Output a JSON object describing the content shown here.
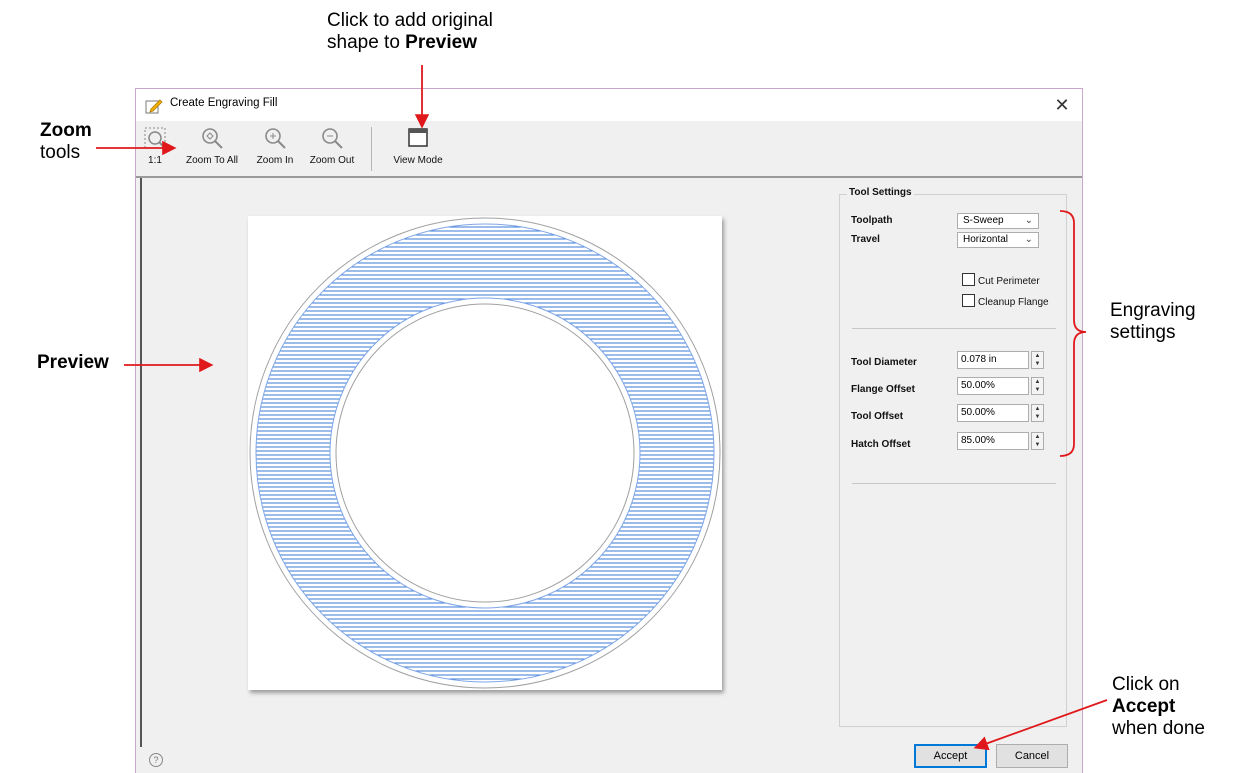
{
  "annotations": {
    "view_mode_note_line1": "Click to add original",
    "view_mode_note_line2": "shape to ",
    "view_mode_note_bold": "Preview",
    "zoom_bold": "Zoom",
    "zoom_rest": "tools",
    "preview_bold": "Preview",
    "engraving_line1": "Engraving",
    "engraving_line2": "settings",
    "accept_line1": "Click on",
    "accept_bold": "Accept",
    "accept_line3": "when done"
  },
  "dialog": {
    "title": "Create Engraving Fill",
    "close_glyph": "✕"
  },
  "toolbar": {
    "one_to_one": "1:1",
    "zoom_to_all": "Zoom To All",
    "zoom_in": "Zoom In",
    "zoom_out": "Zoom Out",
    "view_mode": "View Mode"
  },
  "settings": {
    "group_title": "Tool Settings",
    "toolpath_label": "Toolpath",
    "toolpath_value": "S-Sweep",
    "travel_label": "Travel",
    "travel_value": "Horizontal",
    "cut_perimeter": "Cut Perimeter",
    "cleanup_flange": "Cleanup Flange",
    "tool_diameter_label": "Tool Diameter",
    "tool_diameter_value": "0.078 in",
    "flange_offset_label": "Flange Offset",
    "flange_offset_value": "50.00%",
    "tool_offset_label": "Tool Offset",
    "tool_offset_value": "50.00%",
    "hatch_offset_label": "Hatch Offset",
    "hatch_offset_value": "85.00%"
  },
  "footer": {
    "help_glyph": "?",
    "accept": "Accept",
    "cancel": "Cancel"
  },
  "colors": {
    "hatch": "#3a7ad8",
    "annotation_arrow": "#e0181b"
  }
}
